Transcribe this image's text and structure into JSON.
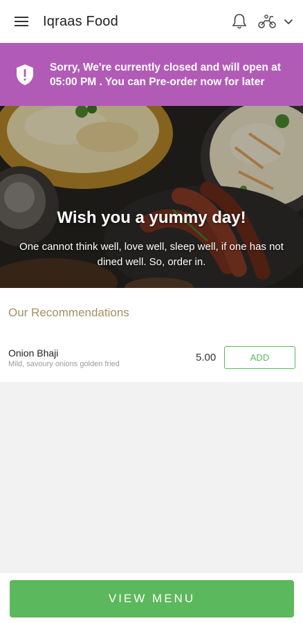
{
  "app_bar": {
    "title": "Iqraas Food",
    "icons": [
      "menu-icon",
      "bell-icon",
      "scooter-icon",
      "chevron-down-icon"
    ]
  },
  "closed_banner": {
    "icon": "shield-alert-icon",
    "message": "Sorry, We're currently closed and will open at 05:00 PM . You can Pre-order now for later",
    "background": "#b25bb6"
  },
  "hero": {
    "title": "Wish you a yummy day!",
    "subtitle": "One cannot think well, love well, sleep well, if one has not dined well. So, order in."
  },
  "recommendations": {
    "title": "Our Recommendations",
    "items": [
      {
        "name": "Onion Bhaji",
        "description": "Mild, savoury onions golden fried",
        "price": "5.00",
        "action_label": "ADD"
      }
    ]
  },
  "footer": {
    "view_menu_label": "VIEW MENU"
  },
  "colors": {
    "accent_green": "#5cb85c",
    "banner_purple": "#b25bb6",
    "section_title": "#a58f63"
  }
}
